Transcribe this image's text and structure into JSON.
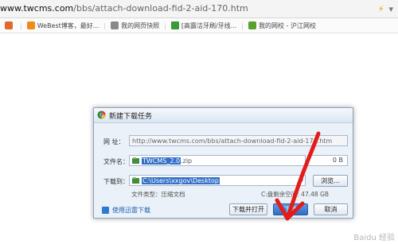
{
  "browser": {
    "url_host": "www.twcms.com",
    "url_path": "/bbs/attach-download-fid-2-aid-170.htm",
    "bookmarks": [
      {
        "label": "",
        "icon": "app-icon"
      },
      {
        "label": "WeBest博客，最好...",
        "icon": "blog-icon"
      },
      {
        "label": "我的网页快照",
        "icon": "camera-icon"
      },
      {
        "label": "[高露洁牙刷/牙线...",
        "icon": "bookmark-icon"
      },
      {
        "label": "我的网校 - 沪江网校",
        "icon": "school-icon"
      }
    ]
  },
  "dialog": {
    "title": "新建下载任务",
    "url_label": "网  址：",
    "url_value": "http://www.twcms.com/bbs/attach-download-fid-2-aid-170.htm",
    "filename_label": "文件名：",
    "filename_selected": "TWCMS_2.0",
    "filename_ext": ".zip",
    "size_value": "0 B",
    "save_to_label": "下载到：",
    "save_to_value": "C:\\Users\\xxgov\\Desktop",
    "browse_label": "浏览...",
    "file_type": "文件类型：压缩文档",
    "free_space": "C:盘剩余空间: 47.48 GB",
    "thunder_link": "使用迅雷下载",
    "download_open_label": "下载并打开",
    "download_label": "下载",
    "cancel_label": "取消"
  },
  "colors": {
    "selection": "#3370c7",
    "primary_button": "#2c6ec6",
    "annotation_arrow": "#e21b1b"
  },
  "watermark": "Baidu 经验"
}
